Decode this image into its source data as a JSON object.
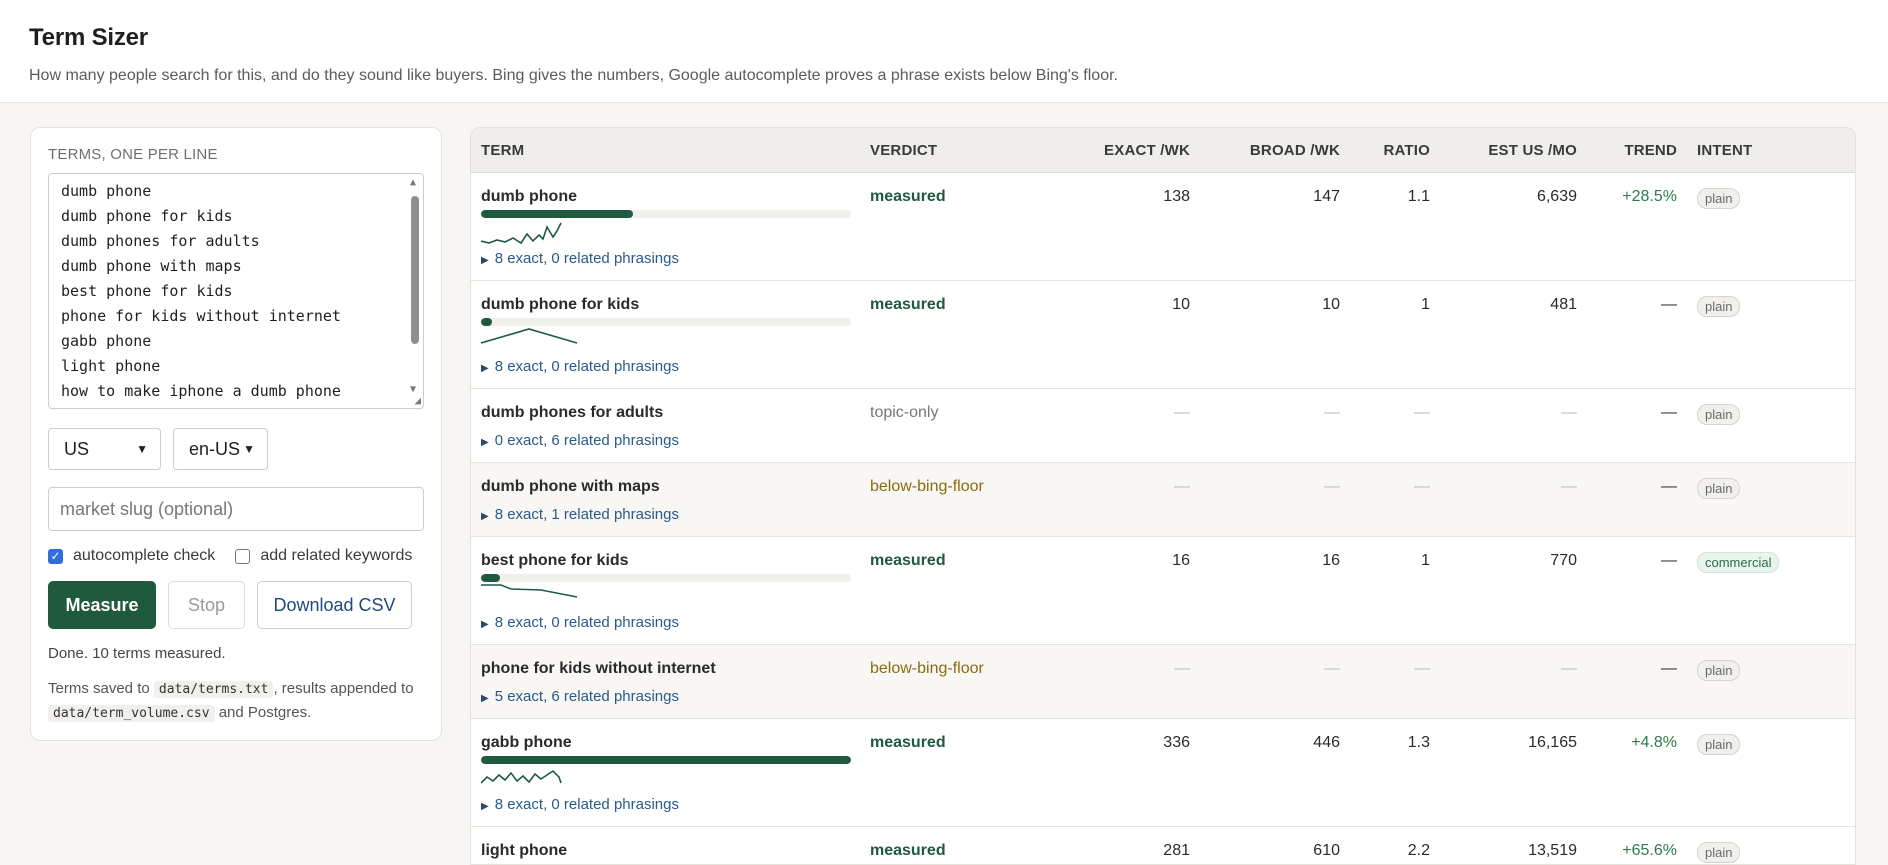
{
  "app": {
    "title": "Term Sizer",
    "subtitle": "How many people search for this, and do they sound like buyers. Bing gives the numbers, Google autocomplete proves a phrase exists below Bing's floor."
  },
  "sidebar": {
    "terms_label": "TERMS, ONE PER LINE",
    "terms": [
      "dumb phone",
      "dumb phone for kids",
      "dumb phones for adults",
      "dumb phone with maps",
      "best phone for kids",
      "phone for kids without internet",
      "gabb phone",
      "light phone",
      "how to make iphone a dumb phone"
    ],
    "country": "US",
    "locale": "en-US",
    "slug_placeholder": "market slug (optional)",
    "autocomplete_label": "autocomplete check",
    "autocomplete_checked": true,
    "related_label": "add related keywords",
    "related_checked": false,
    "measure_label": "Measure",
    "stop_label": "Stop",
    "csv_label": "Download CSV",
    "status": "Done. 10 terms measured.",
    "saved_prefix": "Terms saved to",
    "saved_file1": "data/terms.txt",
    "saved_mid": ", results appended to",
    "saved_file2": "data/term_volume.csv",
    "saved_suffix": "and Postgres."
  },
  "table": {
    "columns": {
      "term": "TERM",
      "verdict": "VERDICT",
      "exact": "EXACT /WK",
      "broad": "BROAD /WK",
      "ratio": "RATIO",
      "est": "EST US /MO",
      "trend": "TREND",
      "intent": "INTENT"
    },
    "rows": [
      {
        "term": "dumb phone",
        "verdict": "measured",
        "exact": "138",
        "broad": "147",
        "ratio": "1.1",
        "est": "6,639",
        "trend": "+28.5%",
        "intent": "plain",
        "bar_fraction": 0.41,
        "phrasings": "8 exact, 0 related phrasings"
      },
      {
        "term": "dumb phone for kids",
        "verdict": "measured",
        "exact": "10",
        "broad": "10",
        "ratio": "1",
        "est": "481",
        "trend": "—",
        "intent": "plain",
        "bar_fraction": 0.03,
        "phrasings": "8 exact, 0 related phrasings"
      },
      {
        "term": "dumb phones for adults",
        "verdict": "topic-only",
        "exact": "—",
        "broad": "—",
        "ratio": "—",
        "est": "—",
        "trend": "—",
        "intent": "plain",
        "phrasings": "0 exact, 6 related phrasings"
      },
      {
        "term": "dumb phone with maps",
        "verdict": "below-bing-floor",
        "exact": "—",
        "broad": "—",
        "ratio": "—",
        "est": "—",
        "trend": "—",
        "intent": "plain",
        "phrasings": "8 exact, 1 related phrasings"
      },
      {
        "term": "best phone for kids",
        "verdict": "measured",
        "exact": "16",
        "broad": "16",
        "ratio": "1",
        "est": "770",
        "trend": "—",
        "intent": "commercial",
        "bar_fraction": 0.05,
        "phrasings": "8 exact, 0 related phrasings"
      },
      {
        "term": "phone for kids without internet",
        "verdict": "below-bing-floor",
        "exact": "—",
        "broad": "—",
        "ratio": "—",
        "est": "—",
        "trend": "—",
        "intent": "plain",
        "phrasings": "5 exact, 6 related phrasings"
      },
      {
        "term": "gabb phone",
        "verdict": "measured",
        "exact": "336",
        "broad": "446",
        "ratio": "1.3",
        "est": "16,165",
        "trend": "+4.8%",
        "intent": "plain",
        "bar_fraction": 1.0,
        "phrasings": "8 exact, 0 related phrasings"
      },
      {
        "term": "light phone",
        "verdict": "measured",
        "exact": "281",
        "broad": "610",
        "ratio": "2.2",
        "est": "13,519",
        "trend": "+65.6%",
        "intent": "plain",
        "phrasings": ""
      }
    ]
  },
  "colors": {
    "accent": "#1f5a3f",
    "link": "#2a5a8a",
    "below_floor": "#8a6a12",
    "trend_positive": "#2d7a4a"
  },
  "icons": {
    "disclosure": "triangle-right-icon",
    "select": "chevron-down-icon",
    "check": "checkmark-icon"
  }
}
